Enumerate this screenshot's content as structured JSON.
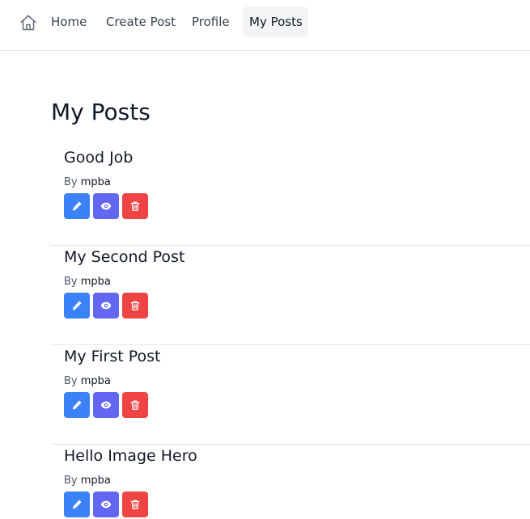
{
  "nav": {
    "home_icon": "home-icon",
    "links": [
      "Home",
      "Create Post",
      "Profile",
      "My Posts"
    ],
    "active": "My Posts"
  },
  "page": {
    "title": "My Posts"
  },
  "posts": [
    {
      "title": "Good Job",
      "by_label": "By",
      "author": "mpba"
    },
    {
      "title": "My Second Post",
      "by_label": "By",
      "author": "mpba"
    },
    {
      "title": "My First Post",
      "by_label": "By",
      "author": "mpba"
    },
    {
      "title": "Hello Image Hero",
      "by_label": "By",
      "author": "mpba"
    }
  ],
  "actions": {
    "icons": [
      "pencil-icon",
      "eye-icon",
      "trash-icon"
    ]
  },
  "colors": {
    "edit": "#3b82f6",
    "view": "#6366f1",
    "delete": "#ef4444",
    "active_nav_bg": "#f3f4f6"
  }
}
